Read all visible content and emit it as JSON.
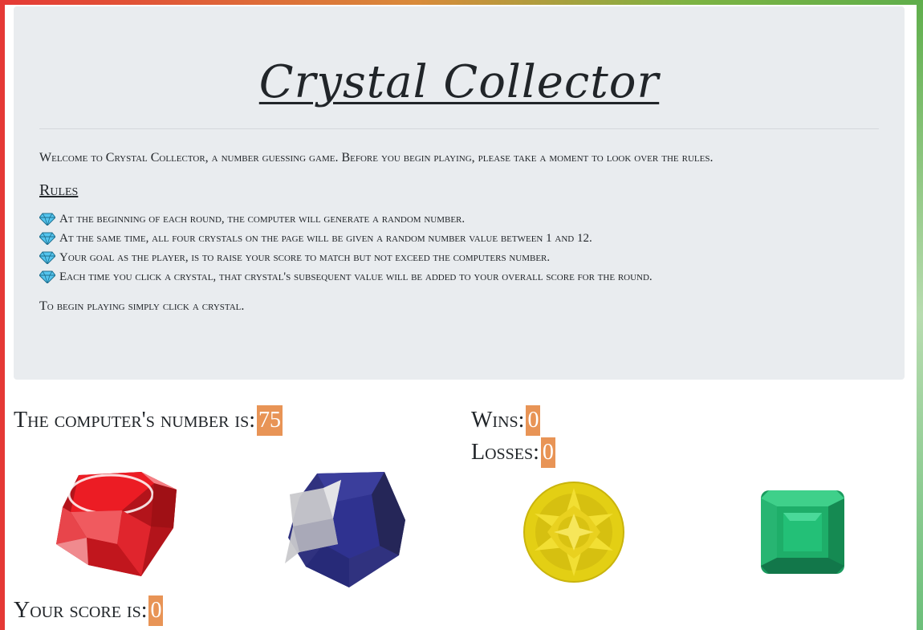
{
  "header": {
    "title": "Crystal Collector",
    "intro": "Welcome to Crystal Collector, a number guessing game. Before you begin playing, please take a moment to look over the rules.",
    "rules_heading": "Rules",
    "rules": [
      "At the beginning of each round, the computer will generate a random number.",
      "At the same time, all four crystals on the page will be given a random number value between 1 and 12.",
      "Your goal as the player, is to raise your score to match but not exceed the computers number.",
      "Each time you click a crystal, that crystal's subsequent value will be added to your overall score for the round."
    ],
    "outro": "To begin playing simply click a crystal."
  },
  "stats": {
    "computer_label": "The computer's number is:",
    "computer_value": "75",
    "wins_label": "Wins:",
    "wins_value": "0",
    "losses_label": "Losses:",
    "losses_value": "0",
    "score_label": "Your score is:",
    "score_value": "0"
  },
  "crystals": [
    {
      "name": "ruby",
      "icon": "ruby-crystal-icon",
      "color": "#e31b23"
    },
    {
      "name": "sapphire",
      "icon": "sapphire-crystal-icon",
      "color": "#2e2f7e"
    },
    {
      "name": "citrine",
      "icon": "yellow-crystal-icon",
      "color": "#e8d41a"
    },
    {
      "name": "emerald",
      "icon": "emerald-crystal-icon",
      "color": "#1fae6a"
    }
  ],
  "colors": {
    "badge": "#e89456",
    "jumbotron": "#e9ecef",
    "bullet": "#3fb4e0"
  }
}
